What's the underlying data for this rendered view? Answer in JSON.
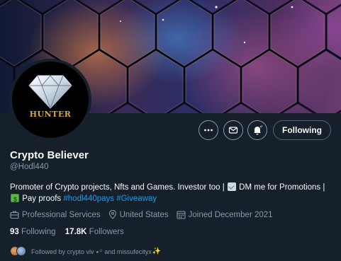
{
  "banner": {
    "description_icon": "hexagon-pattern-banner"
  },
  "avatar": {
    "text": "HUNTER",
    "icon": "diamond-icon"
  },
  "actions": {
    "more_icon": "more-icon",
    "message_icon": "mail-icon",
    "notifications_icon": "bell-icon",
    "following_label": "Following"
  },
  "profile": {
    "display_name": "Crypto Believer",
    "handle": "@Hodl440",
    "bio": {
      "part1": "Promoter of Crypto projects, Nfts and Games. Investor too |",
      "part2": "DM me for Promotions |",
      "part3": "Pay proofs",
      "hashtag1": "#hodl440pays",
      "hashtag2": "#Giveaway"
    },
    "category": "Professional Services",
    "location": "United States",
    "joined": "Joined December 2021"
  },
  "stats": {
    "following_count": "93",
    "following_label": "Following",
    "followers_count": "17.8K",
    "followers_label": "Followers"
  },
  "followed_by": {
    "text": "Followed by crypto viv ⭑꙳ and missufecityx"
  },
  "colors": {
    "background": "#15202b",
    "text_primary": "#f7f9f9",
    "text_secondary": "#8b98a5",
    "link": "#1d9bf0"
  }
}
